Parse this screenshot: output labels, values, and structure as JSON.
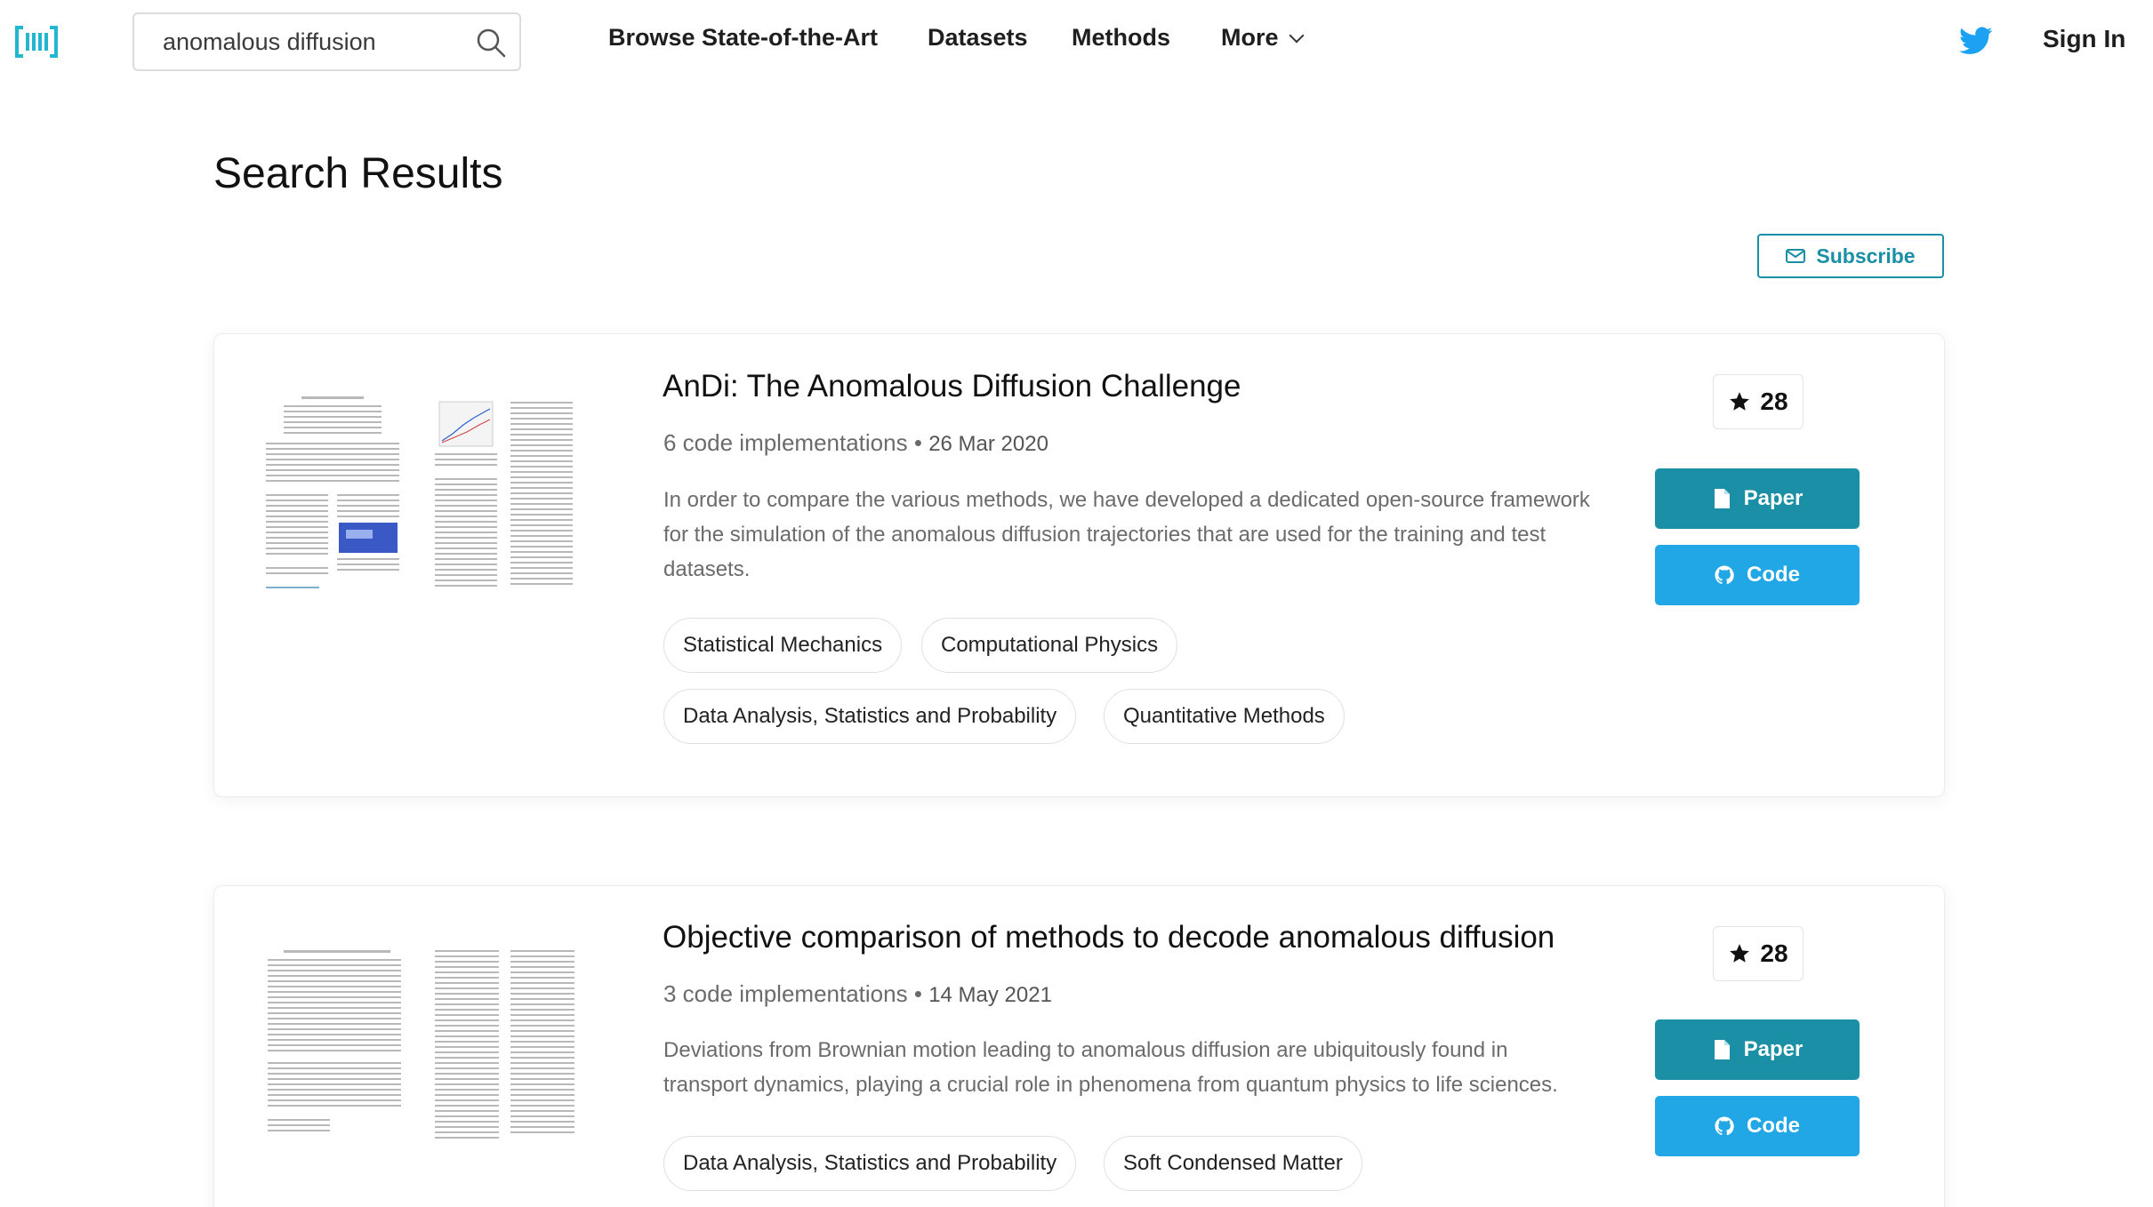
{
  "header": {
    "logo_icon": "paperswithcode-logo-icon",
    "search": {
      "value": "anomalous diffusion",
      "icon": "search-icon"
    },
    "nav": {
      "browse": "Browse State-of-the-Art",
      "datasets": "Datasets",
      "methods": "Methods",
      "more": "More"
    },
    "twitter_icon": "twitter-icon",
    "sign_in": "Sign In"
  },
  "page": {
    "title": "Search Results",
    "subscribe": "Subscribe"
  },
  "results": [
    {
      "title": "AnDi: The Anomalous Diffusion Challenge",
      "code_implementations": "6 code implementations",
      "separator": "•",
      "date": "26 Mar 2020",
      "abstract": "In order to compare the various methods, we have developed a dedicated open-source framework for the simulation of the anomalous diffusion trajectories that are used for the training and test datasets.",
      "tags": [
        "Statistical Mechanics",
        "Computational Physics",
        "Data Analysis, Statistics and Probability",
        "Quantitative Methods"
      ],
      "stars": "28",
      "paper_label": "Paper",
      "code_label": "Code"
    },
    {
      "title": "Objective comparison of methods to decode anomalous diffusion",
      "code_implementations": "3 code implementations",
      "separator": "•",
      "date": "14 May 2021",
      "abstract": "Deviations from Brownian motion leading to anomalous diffusion are ubiquitously found in transport dynamics, playing a crucial role in phenomena from quantum physics to life sciences.",
      "tags": [
        "Data Analysis, Statistics and Probability",
        "Soft Condensed Matter"
      ],
      "stars": "28",
      "paper_label": "Paper",
      "code_label": "Code"
    }
  ],
  "colors": {
    "accent": "#1a8fa6",
    "code_button": "#21a6e6",
    "twitter": "#1da1f2"
  }
}
